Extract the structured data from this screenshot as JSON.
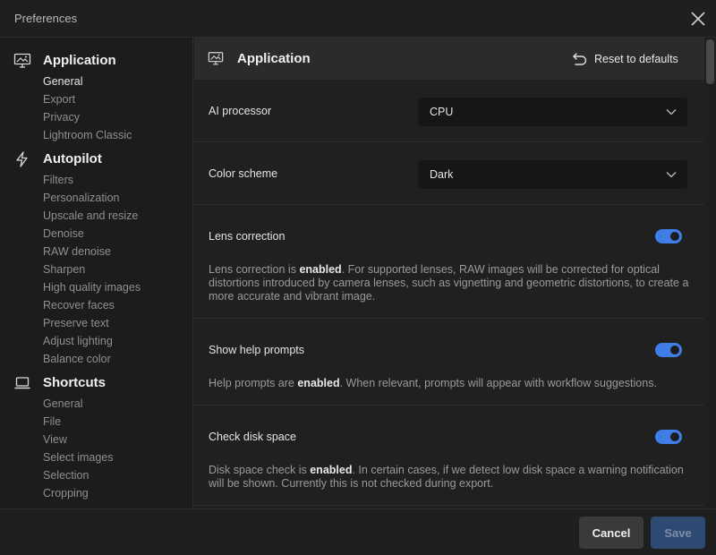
{
  "window": {
    "title": "Preferences"
  },
  "sidebar": {
    "sections": [
      {
        "icon": "monitor-image-icon",
        "title": "Application",
        "items": [
          "General",
          "Export",
          "Privacy",
          "Lightroom Classic"
        ]
      },
      {
        "icon": "lightning-icon",
        "title": "Autopilot",
        "items": [
          "Filters",
          "Personalization",
          "Upscale and resize",
          "Denoise",
          "RAW denoise",
          "Sharpen",
          "High quality images",
          "Recover faces",
          "Preserve text",
          "Adjust lighting",
          "Balance color"
        ]
      },
      {
        "icon": "laptop-icon",
        "title": "Shortcuts",
        "items": [
          "General",
          "File",
          "View",
          "Select images",
          "Selection",
          "Cropping"
        ]
      }
    ],
    "active_item": "General"
  },
  "content": {
    "header": {
      "title": "Application",
      "reset_label": "Reset to defaults"
    },
    "ai_processor": {
      "label": "AI processor",
      "value": "CPU"
    },
    "color_scheme": {
      "label": "Color scheme",
      "value": "Dark"
    },
    "lens_correction": {
      "label": "Lens correction",
      "enabled": true,
      "desc_prefix": "Lens correction is ",
      "desc_state": "enabled",
      "desc_suffix": ". For supported lenses, RAW images will be corrected for optical distortions introduced by camera lenses, such as vignetting and geometric distortions, to create a more accurate and vibrant image."
    },
    "help_prompts": {
      "label": "Show help prompts",
      "enabled": true,
      "desc_prefix": "Help prompts are ",
      "desc_state": "enabled",
      "desc_suffix": ". When relevant, prompts will appear with workflow suggestions."
    },
    "disk_space": {
      "label": "Check disk space",
      "enabled": true,
      "desc_prefix": "Disk space check is ",
      "desc_state": "enabled",
      "desc_suffix": ". In certain cases, if we detect low disk space a warning notification will be shown. Currently this is not checked during export."
    }
  },
  "footer": {
    "cancel_label": "Cancel",
    "save_label": "Save"
  },
  "colors": {
    "accent": "#3f7ee6",
    "save_disabled_bg": "#2d4a72"
  }
}
